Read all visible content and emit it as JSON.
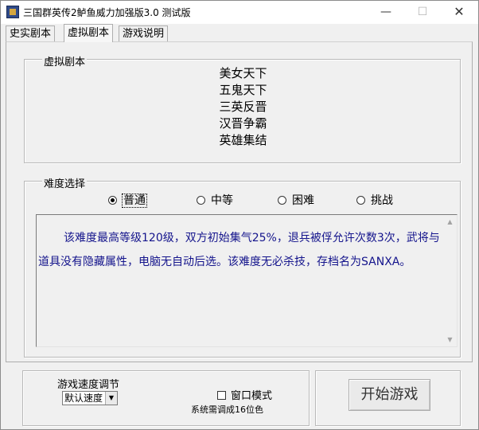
{
  "window": {
    "title": "三国群英传2鲈鱼威力加强版3.0 测试版",
    "controls": {
      "minimize": "—",
      "maximize": "☐",
      "close": "✕"
    }
  },
  "tabs": [
    {
      "label": "史实剧本",
      "selected": false
    },
    {
      "label": "虚拟剧本",
      "selected": true
    },
    {
      "label": "游戏说明",
      "selected": false
    }
  ],
  "virtual_scenarios": {
    "legend": "虚拟剧本",
    "items": [
      "美女天下",
      "五鬼天下",
      "三英反晋",
      "汉晋争霸",
      "英雄集结"
    ]
  },
  "difficulty": {
    "legend": "难度选择",
    "options": [
      {
        "label": "普通",
        "checked": true
      },
      {
        "label": "中等",
        "checked": false
      },
      {
        "label": "困难",
        "checked": false
      },
      {
        "label": "挑战",
        "checked": false
      }
    ],
    "description": "该难度最高等级120级，双方初始集气25%，退兵被俘允许次数3次，武将与道具没有隐藏属性，电脑无自动后选。该难度无必杀技，存档名为SANXA。"
  },
  "speed": {
    "label": "游戏速度调节",
    "selected": "默认速度"
  },
  "window_mode": {
    "label": "窗口模式",
    "checked": false,
    "hint": "系统需调成16位色"
  },
  "start_button": "开始游戏",
  "colors": {
    "description_text": "#14148c",
    "panel_bg": "#f0f0f0"
  }
}
